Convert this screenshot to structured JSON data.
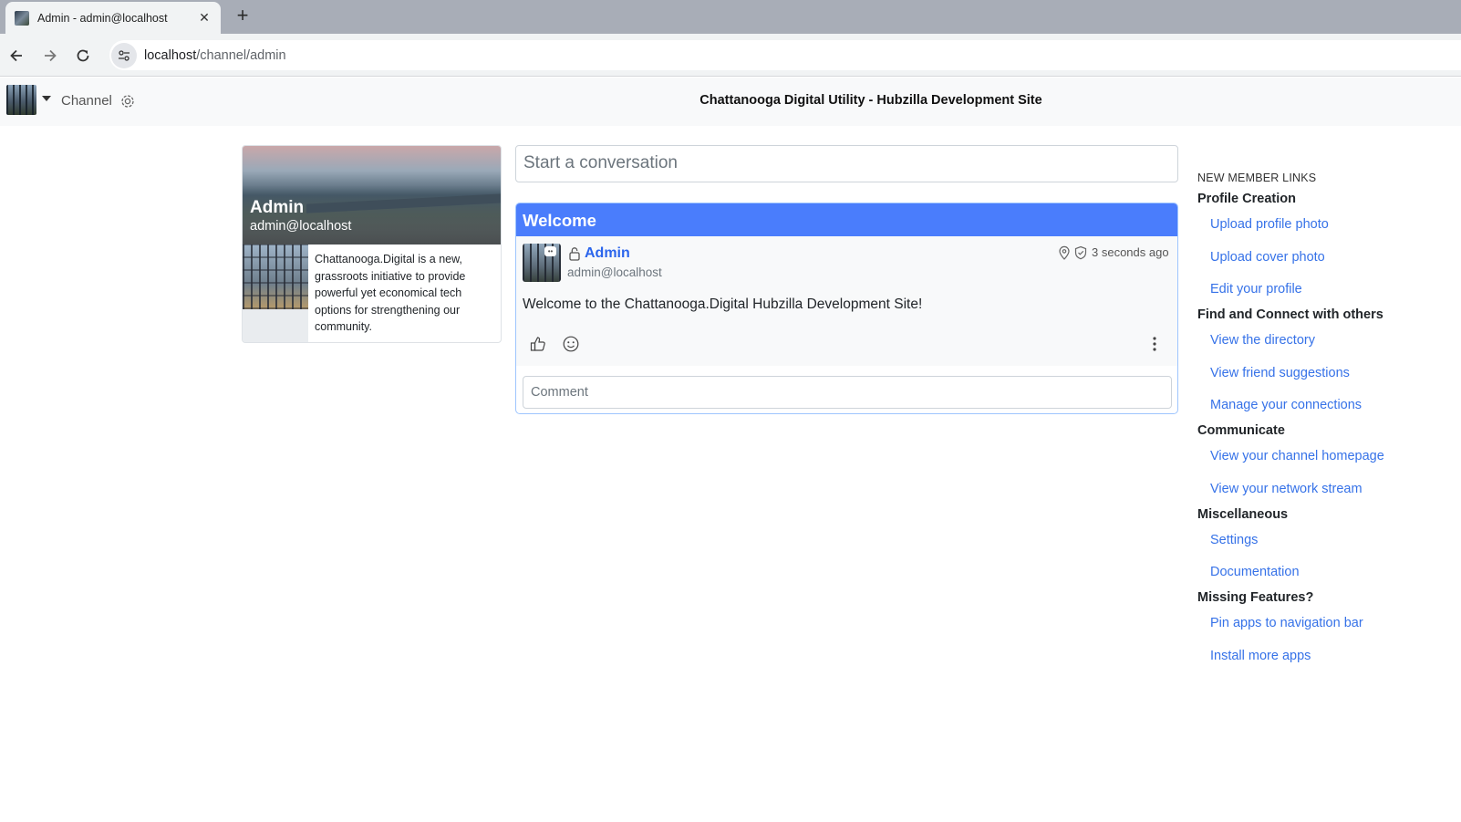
{
  "browser": {
    "tab_title": "Admin - admin@localhost",
    "url_host": "localhost",
    "url_path": "/channel/admin"
  },
  "navbar": {
    "channel_label": "Channel",
    "site_name": "Chattanooga Digital Utility - Hubzilla Development Site"
  },
  "profile": {
    "name": "Admin",
    "handle": "admin@localhost",
    "about": "Chattanooga.Digital is a new, grassroots initiative to provide powerful yet economical tech options for strengthening our community."
  },
  "composer": {
    "placeholder": "Start a conversation"
  },
  "post": {
    "title": "Welcome",
    "author_name": "Admin",
    "author_handle": "admin@localhost",
    "time": "3 seconds ago",
    "body": "Welcome to the Chattanooga.Digital Hubzilla Development Site!",
    "comment_placeholder": "Comment"
  },
  "sidebar": {
    "heading": "NEW MEMBER LINKS",
    "sections": [
      {
        "title": "Profile Creation",
        "links": [
          "Upload profile photo",
          "Upload cover photo",
          "Edit your profile"
        ]
      },
      {
        "title": "Find and Connect with others",
        "links": [
          "View the directory",
          "View friend suggestions",
          "Manage your connections"
        ]
      },
      {
        "title": "Communicate",
        "links": [
          "View your channel homepage",
          "View your network stream"
        ]
      },
      {
        "title": "Miscellaneous",
        "links": [
          "Settings",
          "Documentation"
        ]
      },
      {
        "title": "Missing Features?",
        "links": [
          "Pin apps to navigation bar",
          "Install more apps"
        ]
      }
    ]
  },
  "colors": {
    "post_header": "#4a7dfc",
    "link": "#3672e8"
  }
}
